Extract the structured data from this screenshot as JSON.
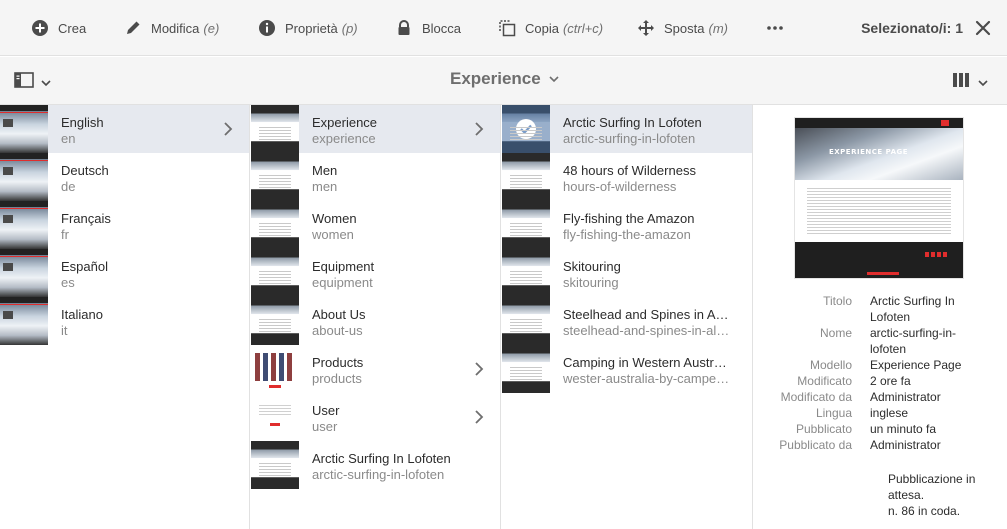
{
  "actionbar": {
    "actions": [
      {
        "label": "Crea",
        "shortcut": "",
        "icon": "add-circle-icon"
      },
      {
        "label": "Modifica",
        "shortcut": "(e)",
        "icon": "pencil-icon"
      },
      {
        "label": "Proprietà",
        "shortcut": "(p)",
        "icon": "info-icon"
      },
      {
        "label": "Blocca",
        "shortcut": "",
        "icon": "lock-icon"
      },
      {
        "label": "Copia",
        "shortcut": "(ctrl+c)",
        "icon": "copy-icon"
      },
      {
        "label": "Sposta",
        "shortcut": "(m)",
        "icon": "move-icon"
      }
    ],
    "more_icon": "more-icon",
    "selection_label": "Selezionato/i: 1",
    "close_icon": "close-icon"
  },
  "header": {
    "title": "Experience",
    "rail_icon": "rail-toggle-icon",
    "view_icon": "column-view-icon"
  },
  "columns": [
    {
      "items": [
        {
          "title": "English",
          "name": "en",
          "has_children": true,
          "active": true,
          "thumb": "hero"
        },
        {
          "title": "Deutsch",
          "name": "de",
          "has_children": false,
          "active": false,
          "thumb": "hero"
        },
        {
          "title": "Français",
          "name": "fr",
          "has_children": false,
          "active": false,
          "thumb": "hero"
        },
        {
          "title": "Español",
          "name": "es",
          "has_children": false,
          "active": false,
          "thumb": "hero"
        },
        {
          "title": "Italiano",
          "name": "it",
          "has_children": false,
          "active": false,
          "thumb": "hero"
        }
      ]
    },
    {
      "items": [
        {
          "title": "Experience",
          "name": "experience",
          "has_children": true,
          "active": true,
          "thumb": "page"
        },
        {
          "title": "Men",
          "name": "men",
          "has_children": false,
          "active": false,
          "thumb": "page"
        },
        {
          "title": "Women",
          "name": "women",
          "has_children": false,
          "active": false,
          "thumb": "page"
        },
        {
          "title": "Equipment",
          "name": "equipment",
          "has_children": false,
          "active": false,
          "thumb": "page"
        },
        {
          "title": "About Us",
          "name": "about-us",
          "has_children": false,
          "active": false,
          "thumb": "page"
        },
        {
          "title": "Products",
          "name": "products",
          "has_children": true,
          "active": false,
          "thumb": "prod"
        },
        {
          "title": "User",
          "name": "user",
          "has_children": true,
          "active": false,
          "thumb": "user"
        },
        {
          "title": "Arctic Surfing In Lofoten",
          "name": "arctic-surfing-in-lofoten",
          "has_children": false,
          "active": false,
          "thumb": "page"
        }
      ]
    },
    {
      "items": [
        {
          "title": "Arctic Surfing In Lofoten",
          "name": "arctic-surfing-in-lofoten",
          "has_children": false,
          "active": true,
          "selected": true,
          "thumb": "page"
        },
        {
          "title": "48 hours of Wilderness",
          "name": "hours-of-wilderness",
          "has_children": false,
          "active": false,
          "thumb": "page"
        },
        {
          "title": "Fly-fishing the Amazon",
          "name": "fly-fishing-the-amazon",
          "has_children": false,
          "active": false,
          "thumb": "page"
        },
        {
          "title": "Skitouring",
          "name": "skitouring",
          "has_children": false,
          "active": false,
          "thumb": "page"
        },
        {
          "title": "Steelhead and Spines in Alaska",
          "name": "steelhead-and-spines-in-alaska",
          "has_children": false,
          "active": false,
          "thumb": "page"
        },
        {
          "title": "Camping in Western Australia",
          "name": "wester-australia-by-camper-van",
          "has_children": false,
          "active": false,
          "thumb": "page"
        }
      ]
    }
  ],
  "preview": {
    "hero_text": "EXPERIENCE PAGE",
    "properties": [
      {
        "key": "Titolo",
        "value": "Arctic Surfing In Lofoten"
      },
      {
        "key": "Nome",
        "value": "arctic-surfing-in-lofoten"
      },
      {
        "key": "Modello",
        "value": "Experience Page"
      },
      {
        "key": "Modificato",
        "value": "2 ore fa"
      },
      {
        "key": "Modificato da",
        "value": "Administrator"
      },
      {
        "key": "Lingua",
        "value": "inglese"
      },
      {
        "key": "Pubblicato",
        "value": "un minuto fa"
      },
      {
        "key": "Pubblicato da",
        "value": "Administrator"
      }
    ],
    "pending_text": "Pubblicazione in attesa.",
    "queue_text": "n. 86 in coda."
  }
}
